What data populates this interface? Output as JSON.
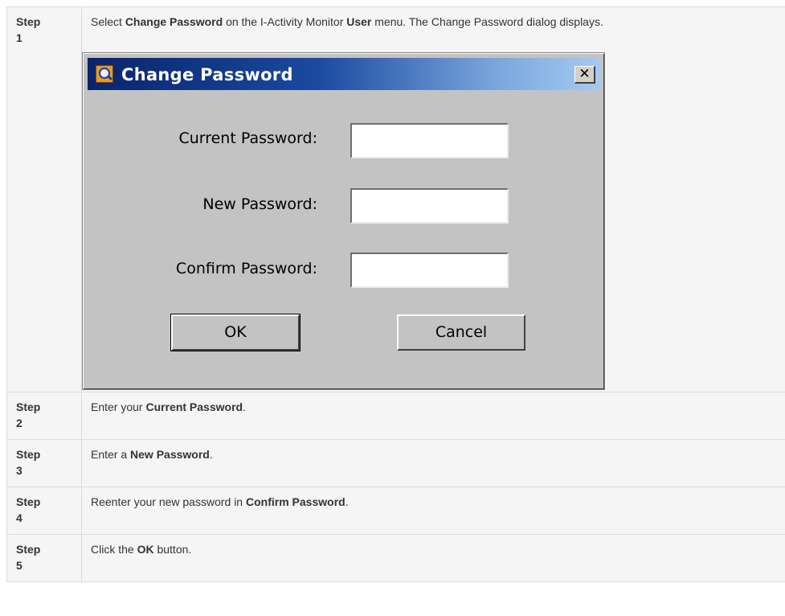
{
  "steps": [
    {
      "label_word": "Step",
      "label_num": "1",
      "parts": [
        "Select ",
        "Change Password",
        " on the I-Activity Monitor ",
        "User",
        " menu. The Change Password dialog displays."
      ]
    },
    {
      "label_word": "Step",
      "label_num": "2",
      "parts": [
        "Enter your ",
        "Current Password",
        "."
      ]
    },
    {
      "label_word": "Step",
      "label_num": "3",
      "parts": [
        "Enter a ",
        "New Password",
        "."
      ]
    },
    {
      "label_word": "Step",
      "label_num": "4",
      "parts": [
        "Reenter your new password in ",
        "Confirm Password",
        "."
      ]
    },
    {
      "label_word": "Step",
      "label_num": "5",
      "parts": [
        "Click the ",
        "OK",
        " button."
      ]
    }
  ],
  "dialog": {
    "title": "Change Password",
    "close_symbol": "✕",
    "app_icon": "magnifier-icon",
    "fields": [
      {
        "label": "Current Password:",
        "value": ""
      },
      {
        "label": "New Password:",
        "value": ""
      },
      {
        "label": "Confirm Password:",
        "value": ""
      }
    ],
    "ok_label": "OK",
    "cancel_label": "Cancel"
  },
  "colors": {
    "titlebar_start": "#0a246a",
    "titlebar_end": "#a6caf0",
    "dialog_face": "#c3c3c3",
    "table_cell": "#f5f5f5"
  }
}
